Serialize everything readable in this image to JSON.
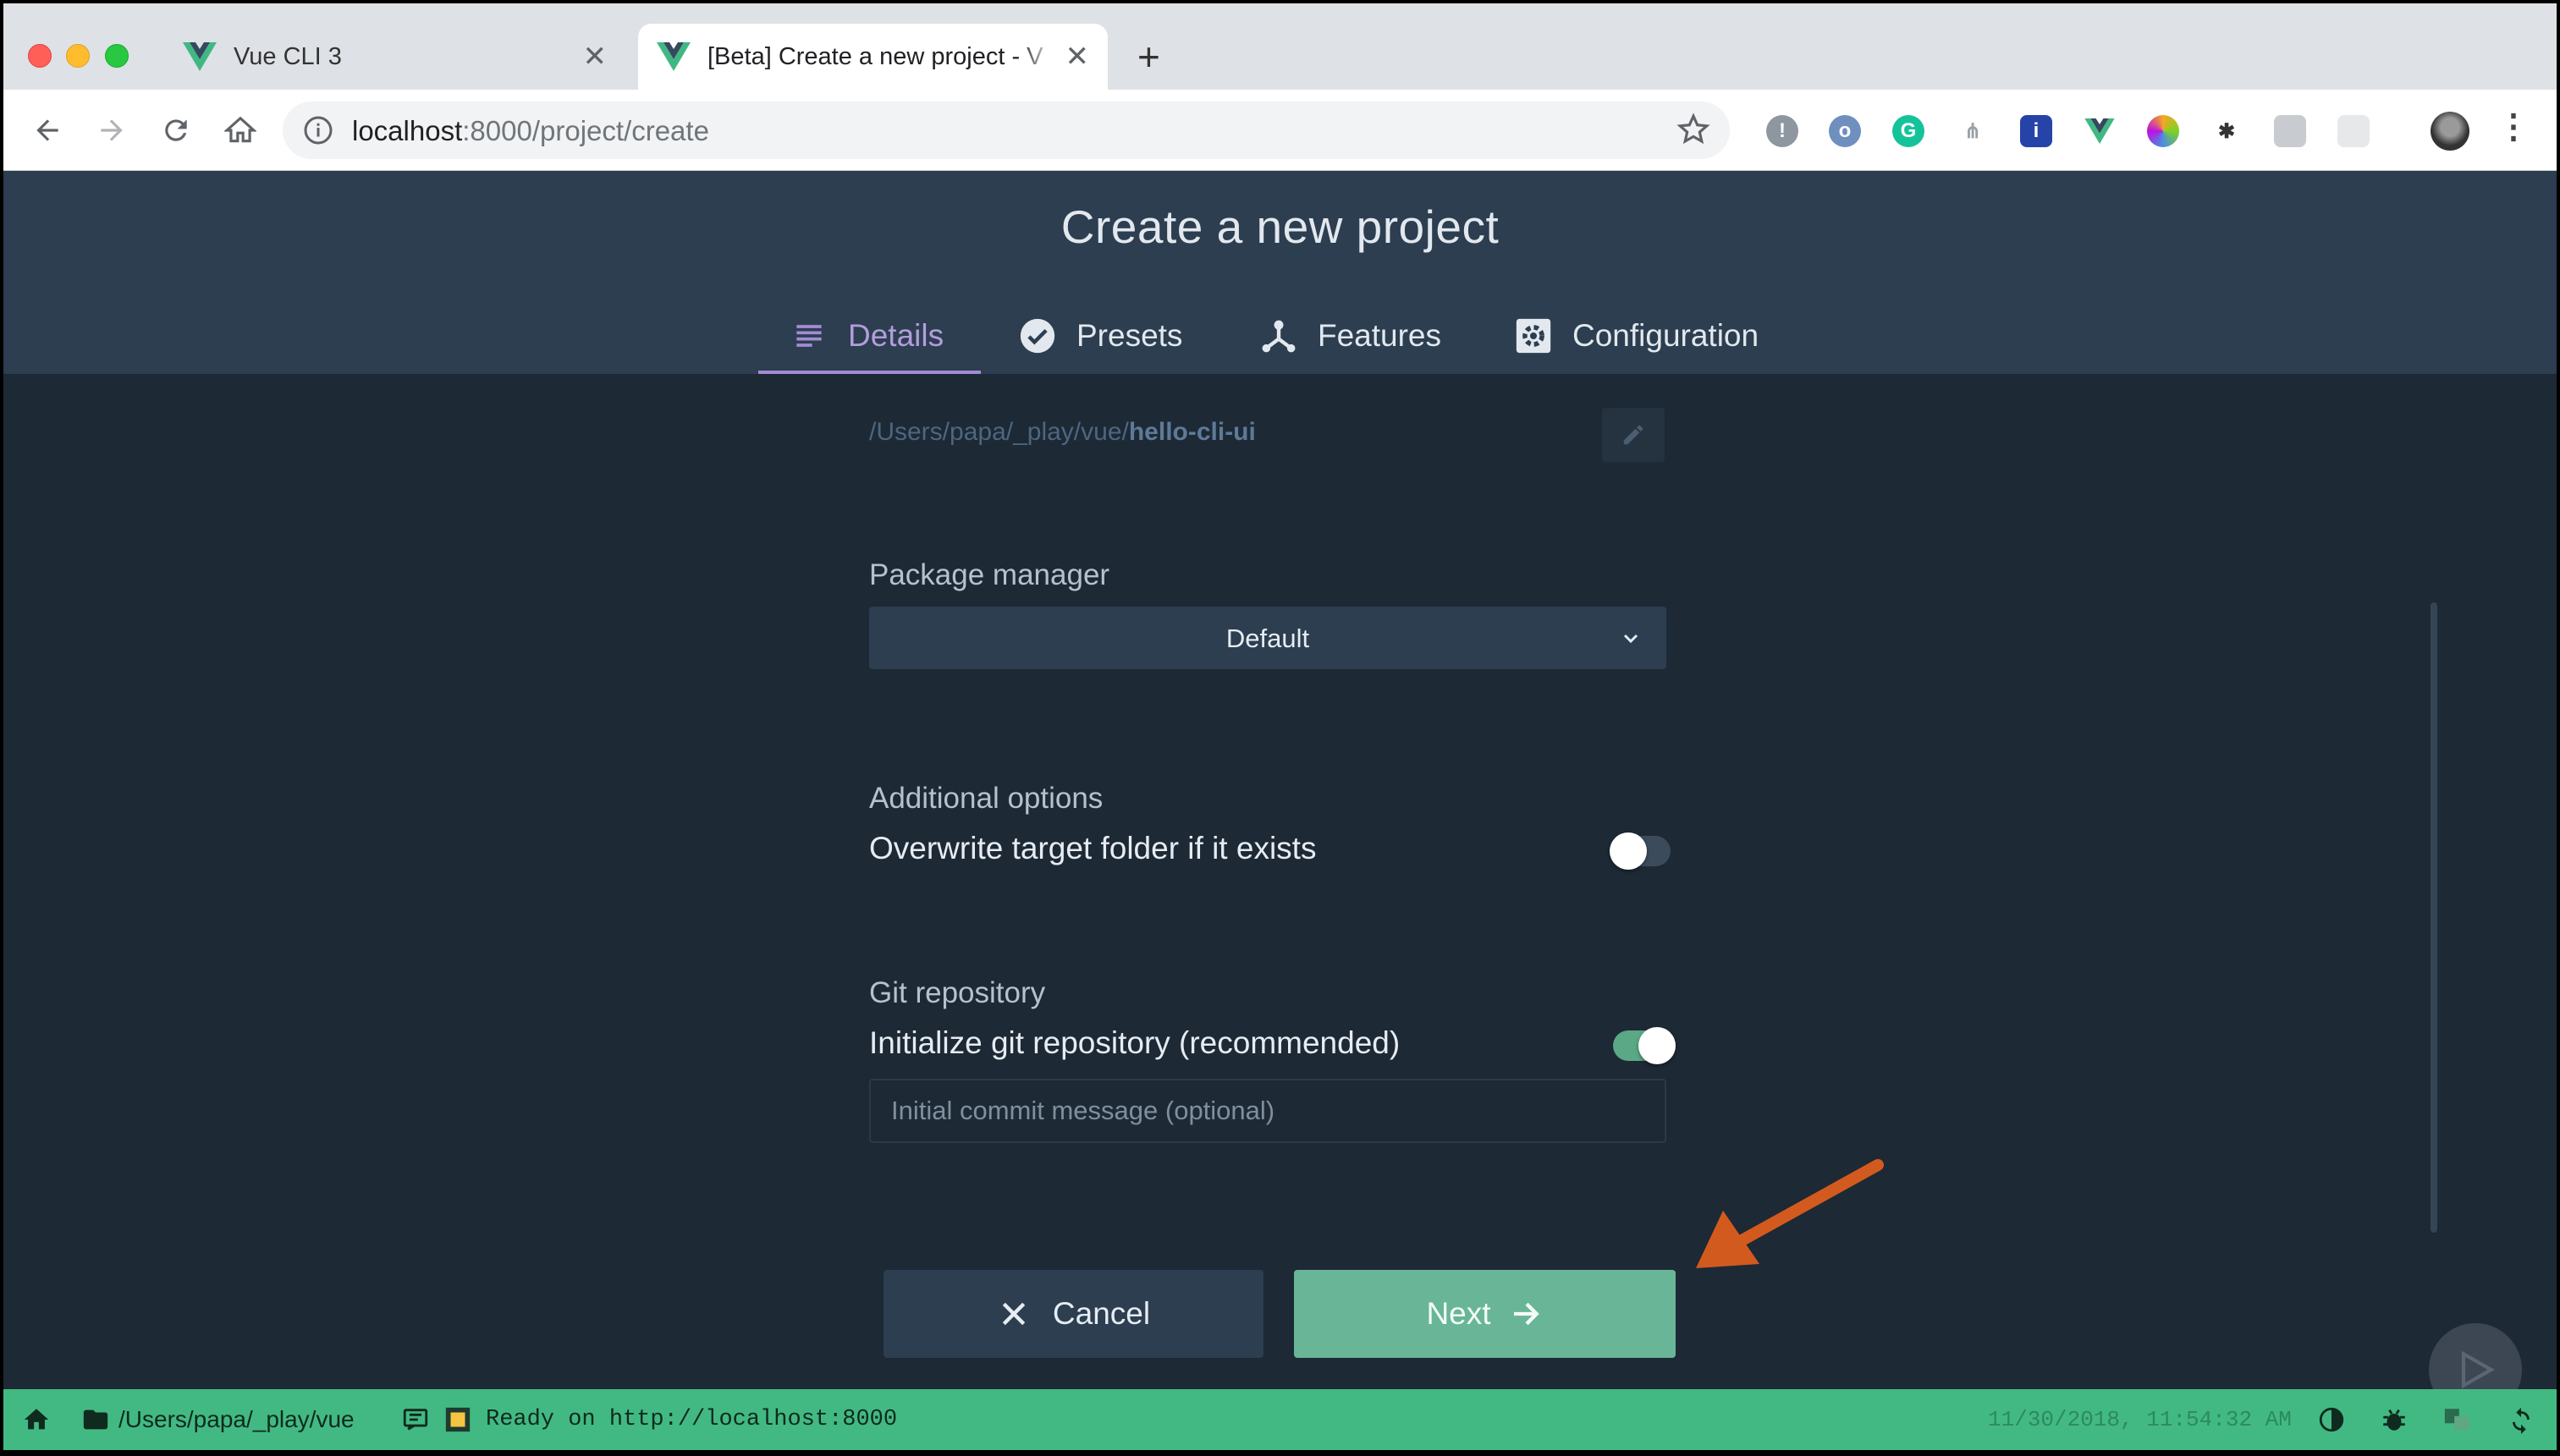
{
  "browser": {
    "tabs": [
      {
        "title": "Vue CLI 3"
      },
      {
        "title": "[Beta] Create a new project - V"
      }
    ],
    "url_host": "localhost",
    "url_rest": ":8000/project/create",
    "new_tab_symbol": "+",
    "close_symbol": "✕",
    "extensions": [
      "lock-extension-icon",
      "blue-circle-extension-icon",
      "grammarly-icon",
      "sitemap-extension-icon",
      "ublock-icon",
      "vue-devtools-icon",
      "color-picker-icon",
      "bug-extension-icon",
      "chat-extension-icon",
      "grid-extension-icon"
    ]
  },
  "header": {
    "title": "Create a new project",
    "tabs": [
      {
        "label": "Details",
        "icon": "subject-icon"
      },
      {
        "label": "Presets",
        "icon": "check-circle-icon"
      },
      {
        "label": "Features",
        "icon": "device-hub-icon"
      },
      {
        "label": "Configuration",
        "icon": "settings-applications-icon"
      }
    ]
  },
  "form": {
    "path_prefix": "/Users/papa/_play/vue/",
    "path_project": "hello-cli-ui",
    "package_manager": {
      "label": "Package manager",
      "value": "Default"
    },
    "additional": {
      "label": "Additional options",
      "option": "Overwrite target folder if it exists",
      "checked": false
    },
    "git": {
      "label": "Git repository",
      "option": "Initialize git repository (recommended)",
      "checked": true,
      "placeholder": "Initial commit message (optional)"
    }
  },
  "actions": {
    "cancel": "Cancel",
    "next": "Next"
  },
  "statusbar": {
    "cwd": "/Users/papa/_play/vue",
    "log": "Ready on http://localhost:8000",
    "datetime": "11/30/2018, 11:54:32 AM"
  },
  "colors": {
    "accent": "#42b983",
    "header_bg": "#2c3e50",
    "content_bg": "#1d2935",
    "active_tab": "#a48bd6",
    "next_button": "#68b697"
  }
}
